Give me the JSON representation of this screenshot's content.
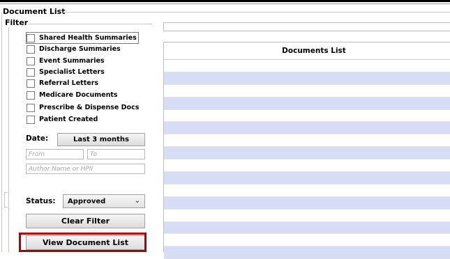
{
  "panel": {
    "title": "Document List"
  },
  "filter": {
    "title": "Filter",
    "checkboxes": [
      "Shared Health Summaries",
      "Discharge Summaries",
      "Event Summaries",
      "Specialist Letters",
      "Referral Letters",
      "Medicare Documents",
      "Prescribe & Dispense Docs",
      "Patient Created"
    ],
    "date_label": "Date:",
    "date_button": "Last 3 months",
    "from_placeholder": "From",
    "to_placeholder": "To",
    "author_placeholder": "Author Name or HPII",
    "status_label": "Status:",
    "status_value": "Approved",
    "clear_button": "Clear Filter",
    "view_button": "View Document List"
  },
  "grid": {
    "header": "Documents List"
  },
  "colors": {
    "row_alt": "#d6ddf5",
    "highlight": "#b00000"
  }
}
